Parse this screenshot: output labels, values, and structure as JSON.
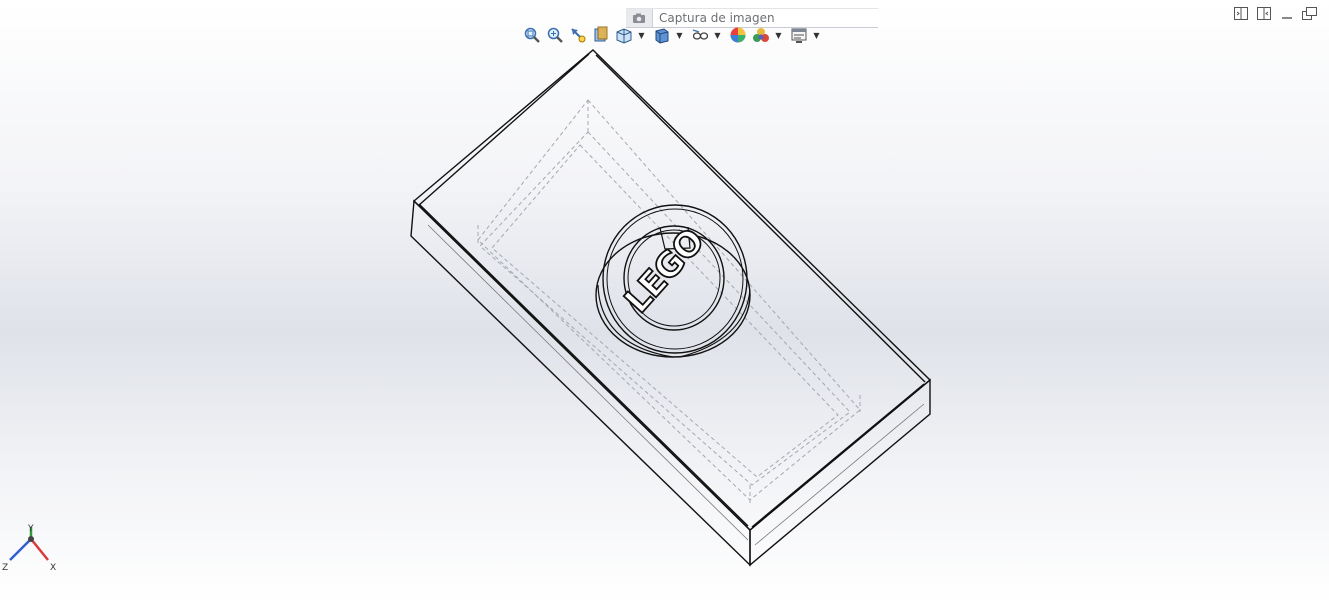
{
  "caption": {
    "placeholder": "Captura de imagen",
    "camera_icon": "camera-icon"
  },
  "toolbar": {
    "icons": [
      "zoom-to-fit-icon",
      "zoom-to-area-icon",
      "previous-view-icon",
      "section-view-icon",
      "view-orientation-icon",
      "display-style-icon",
      "hide-show-items-icon",
      "edit-appearance-icon",
      "apply-scene-icon",
      "view-settings-icon"
    ]
  },
  "triad": {
    "x_label": "X",
    "y_label": "Y",
    "z_label": "Z"
  },
  "model": {
    "logo_text": "LEGO",
    "colors": {
      "edge": "#111111",
      "hidden": "#9aa0a8"
    }
  },
  "colors": {
    "accent": "#1e63b5"
  }
}
